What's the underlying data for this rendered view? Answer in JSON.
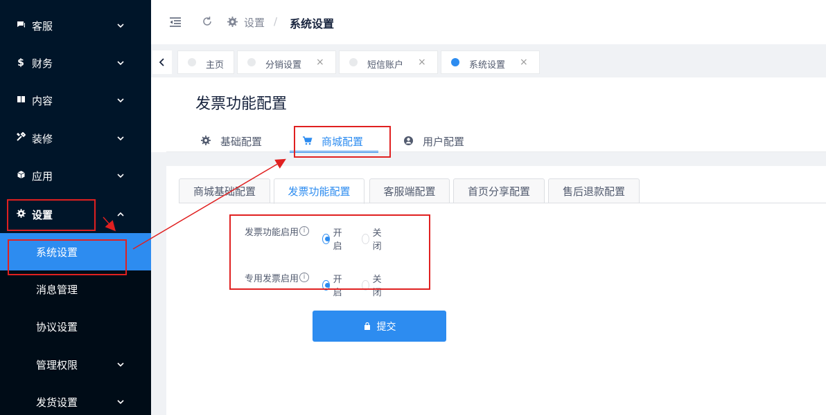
{
  "sidebar": {
    "items": [
      {
        "icon": "chat-icon",
        "label": "客服"
      },
      {
        "icon": "dollar-icon",
        "label": "财务"
      },
      {
        "icon": "book-icon",
        "label": "内容"
      },
      {
        "icon": "tools-icon",
        "label": "装修"
      },
      {
        "icon": "cube-icon",
        "label": "应用"
      },
      {
        "icon": "gear-icon",
        "label": "设置"
      }
    ],
    "sub_items": [
      {
        "label": "系统设置"
      },
      {
        "label": "消息管理"
      },
      {
        "label": "协议设置"
      },
      {
        "label": "管理权限"
      },
      {
        "label": "发货设置"
      }
    ]
  },
  "header": {
    "breadcrumb": [
      "设置",
      "系统设置"
    ],
    "separator": "/"
  },
  "page_tabs": [
    {
      "label": "主页"
    },
    {
      "label": "分销设置",
      "close": "×"
    },
    {
      "label": "短信账户",
      "close": "×"
    },
    {
      "label": "系统设置",
      "close": "×"
    }
  ],
  "main": {
    "title": "发票功能配置",
    "tabs": [
      {
        "icon": "gear-icon",
        "label": "基础配置"
      },
      {
        "icon": "cart-icon",
        "label": "商城配置"
      },
      {
        "icon": "user-circle-icon",
        "label": "用户配置"
      }
    ],
    "card_tabs": [
      "商城基础配置",
      "发票功能配置",
      "客服端配置",
      "首页分享配置",
      "售后退款配置"
    ],
    "form": {
      "rows": [
        {
          "label": "发票功能启用",
          "info": "i",
          "options": [
            "开启",
            "关闭"
          ],
          "selected": "开启"
        },
        {
          "label": "专用发票启用",
          "info": "i",
          "options": [
            "开启",
            "关闭"
          ],
          "selected": "开启"
        }
      ],
      "submit_label": "提交"
    }
  },
  "colors": {
    "sidebar_bg": "#001529",
    "submenu_bg": "#000c17",
    "accent": "#2d8cf0",
    "annotation_red": "#e02020"
  }
}
